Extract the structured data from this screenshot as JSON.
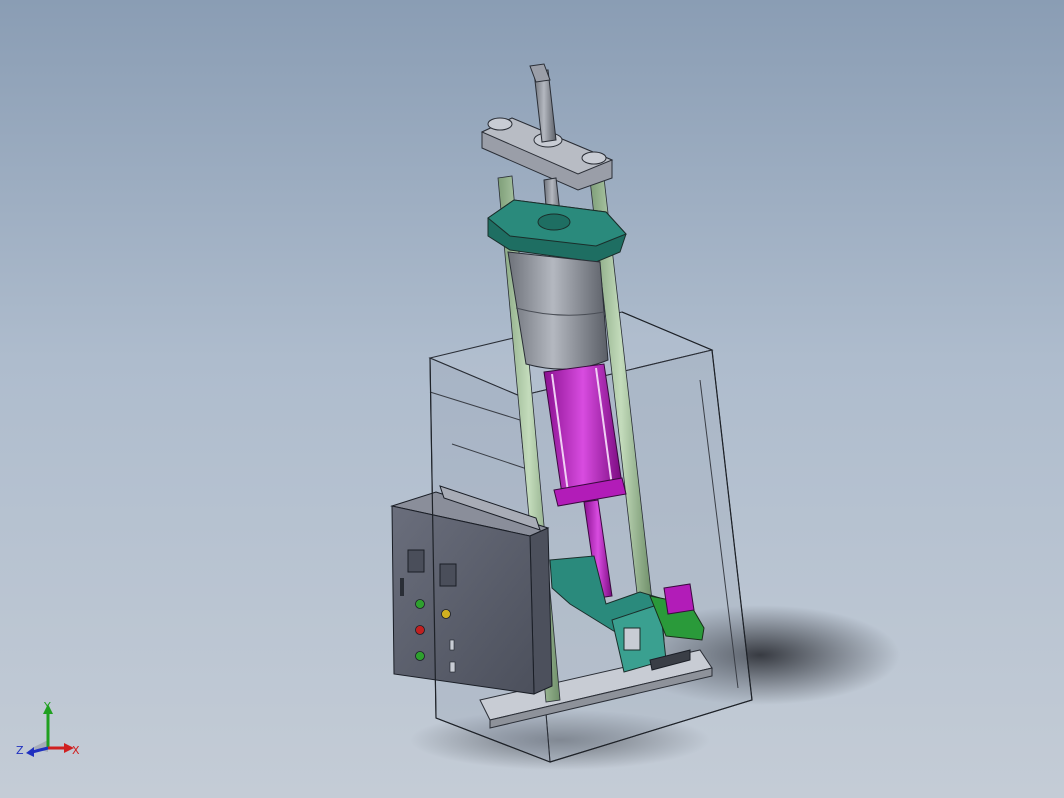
{
  "triad": {
    "x_label": "X",
    "y_label": "Y",
    "z_label": "Z",
    "x_color": "#d02020",
    "y_color": "#20a020",
    "z_color": "#2030c0"
  },
  "colors": {
    "background_top": "#8a9db4",
    "background_bottom": "#c4ccd6",
    "enclosure": "#9aa6b8",
    "cylinder_gray": "#8e929a",
    "teal_plate": "#2a8a7c",
    "green_rod": "#98b892",
    "magenta_rod": "#b21cb8",
    "control_box": "#5c6070",
    "lamp_green": "#2ea02e",
    "lamp_red": "#c02020",
    "lamp_yellow": "#d0b020"
  }
}
